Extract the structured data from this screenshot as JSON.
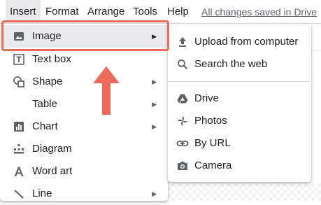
{
  "menubar": {
    "items": [
      "Insert",
      "Format",
      "Arrange",
      "Tools",
      "Help"
    ],
    "saved_status": "All changes saved in Drive"
  },
  "insert_menu": {
    "items": [
      {
        "label": "Image",
        "icon": "image-icon",
        "has_submenu": true,
        "highlighted": true
      },
      {
        "label": "Text box",
        "icon": "text-box-icon",
        "has_submenu": false
      },
      {
        "label": "Shape",
        "icon": "shape-icon",
        "has_submenu": true
      },
      {
        "label": "Table",
        "icon": "",
        "has_submenu": true
      },
      {
        "label": "Chart",
        "icon": "chart-icon",
        "has_submenu": true
      },
      {
        "label": "Diagram",
        "icon": "diagram-icon",
        "has_submenu": false
      },
      {
        "label": "Word art",
        "icon": "word-art-icon",
        "has_submenu": false
      },
      {
        "label": "Line",
        "icon": "line-icon",
        "has_submenu": true
      }
    ],
    "submenu_arrow": "▶"
  },
  "image_submenu": {
    "items": [
      {
        "label": "Upload from computer",
        "icon": "upload-icon"
      },
      {
        "label": "Search the web",
        "icon": "search-icon"
      },
      {
        "label": "Drive",
        "icon": "drive-icon"
      },
      {
        "label": "Photos",
        "icon": "photos-icon"
      },
      {
        "label": "By URL",
        "icon": "link-icon"
      },
      {
        "label": "Camera",
        "icon": "camera-icon"
      }
    ]
  },
  "colors": {
    "annotation_red": "#ee6a5b",
    "hover_gray": "#e8eaed",
    "icon_gray": "#5f6368"
  }
}
